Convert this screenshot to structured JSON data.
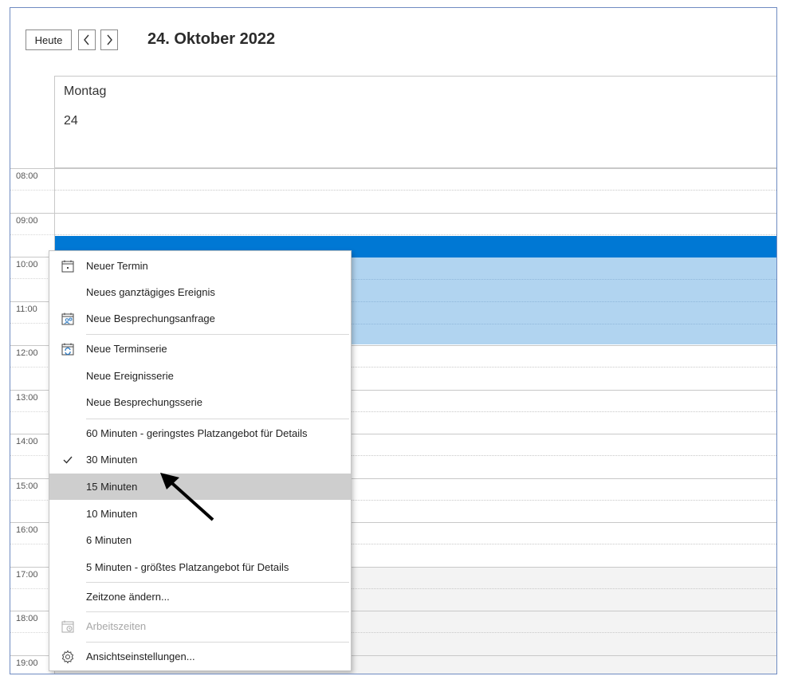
{
  "toolbar": {
    "today_label": "Heute",
    "prev_icon": "chevron-left-icon",
    "next_icon": "chevron-right-icon",
    "date_title": "24. Oktober 2022"
  },
  "day": {
    "name": "Montag",
    "number": "24"
  },
  "hours": [
    "08:00",
    "09:00",
    "10:00",
    "11:00",
    "12:00",
    "13:00",
    "14:00",
    "15:00",
    "16:00",
    "17:00",
    "18:00",
    "19:00"
  ],
  "context_menu": {
    "items": [
      {
        "label": "Neuer Termin",
        "icon": "calendar-icon",
        "checked": false,
        "disabled": false,
        "highlighted": false
      },
      {
        "label": "Neues ganztägiges Ereignis",
        "icon": "",
        "checked": false,
        "disabled": false,
        "highlighted": false
      },
      {
        "label": "Neue Besprechungsanfrage",
        "icon": "meeting-request-icon",
        "checked": false,
        "disabled": false,
        "highlighted": false
      },
      {
        "label": "Neue Terminserie",
        "icon": "recurring-appointment-icon",
        "checked": false,
        "disabled": false,
        "highlighted": false
      },
      {
        "label": "Neue Ereignisserie",
        "icon": "",
        "checked": false,
        "disabled": false,
        "highlighted": false
      },
      {
        "label": "Neue Besprechungsserie",
        "icon": "",
        "checked": false,
        "disabled": false,
        "highlighted": false
      },
      {
        "label": "60 Minuten - geringstes Platzangebot für Details",
        "icon": "",
        "checked": false,
        "disabled": false,
        "highlighted": false
      },
      {
        "label": "30 Minuten",
        "icon": "checkmark-icon",
        "checked": true,
        "disabled": false,
        "highlighted": false
      },
      {
        "label": "15 Minuten",
        "icon": "",
        "checked": false,
        "disabled": false,
        "highlighted": true
      },
      {
        "label": "10 Minuten",
        "icon": "",
        "checked": false,
        "disabled": false,
        "highlighted": false
      },
      {
        "label": "6 Minuten",
        "icon": "",
        "checked": false,
        "disabled": false,
        "highlighted": false
      },
      {
        "label": "5 Minuten - größtes Platzangebot für Details",
        "icon": "",
        "checked": false,
        "disabled": false,
        "highlighted": false
      },
      {
        "label": "Zeitzone ändern...",
        "icon": "",
        "checked": false,
        "disabled": false,
        "highlighted": false
      },
      {
        "label": "Arbeitszeiten",
        "icon": "work-hours-icon",
        "checked": false,
        "disabled": true,
        "highlighted": false
      },
      {
        "label": "Ansichtseinstellungen...",
        "icon": "gear-icon",
        "checked": false,
        "disabled": false,
        "highlighted": false
      }
    ]
  },
  "colors": {
    "selection_header": "#0078d4",
    "selection_body": "#b1d4f0",
    "menu_highlight": "#cecece",
    "frame_border": "#6f8bc1"
  }
}
